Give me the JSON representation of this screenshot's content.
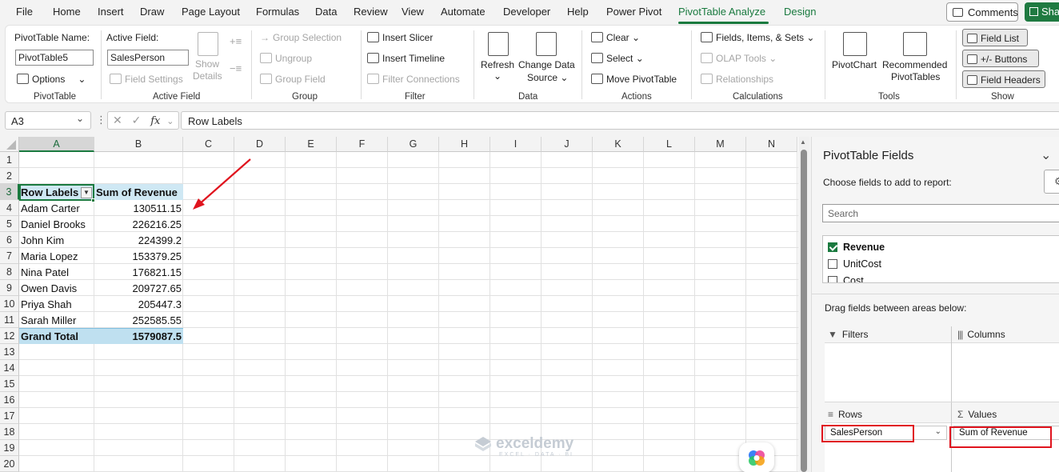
{
  "menu": {
    "tabs": [
      "File",
      "Home",
      "Insert",
      "Draw",
      "Page Layout",
      "Formulas",
      "Data",
      "Review",
      "View",
      "Automate",
      "Developer",
      "Help",
      "Power Pivot",
      "PivotTable Analyze",
      "Design"
    ],
    "active_tab": "PivotTable Analyze",
    "comments_label": "Comments",
    "share_label": "Share"
  },
  "ribbon": {
    "pivottable": {
      "name_label": "PivotTable Name:",
      "name_value": "PivotTable5",
      "options_label": "Options",
      "group_label": "PivotTable"
    },
    "active_field": {
      "label": "Active Field:",
      "value": "SalesPerson",
      "field_settings": "Field Settings",
      "show_details_1": "Show",
      "show_details_2": "Details",
      "group_label": "Active Field"
    },
    "group": {
      "group_selection": "Group Selection",
      "ungroup": "Ungroup",
      "group_field": "Group Field",
      "group_label": "Group"
    },
    "filter": {
      "insert_slicer": "Insert Slicer",
      "insert_timeline": "Insert Timeline",
      "filter_connections": "Filter Connections",
      "group_label": "Filter"
    },
    "data": {
      "refresh": "Refresh",
      "change_source_1": "Change Data",
      "change_source_2": "Source",
      "group_label": "Data"
    },
    "actions": {
      "clear": "Clear",
      "select": "Select",
      "move": "Move PivotTable",
      "group_label": "Actions"
    },
    "calculations": {
      "fields_items": "Fields, Items, & Sets",
      "olap": "OLAP Tools",
      "relationships": "Relationships",
      "group_label": "Calculations"
    },
    "tools": {
      "pivotchart": "PivotChart",
      "recommended_1": "Recommended",
      "recommended_2": "PivotTables",
      "group_label": "Tools"
    },
    "show": {
      "field_list": "Field List",
      "buttons": "+/- Buttons",
      "field_headers": "Field Headers",
      "group_label": "Show"
    }
  },
  "formula_bar": {
    "name_box": "A3",
    "fx": "fx",
    "value": "Row Labels"
  },
  "sheet": {
    "columns": [
      "A",
      "B",
      "C",
      "D",
      "E",
      "F",
      "G",
      "H",
      "I",
      "J",
      "K",
      "L",
      "M",
      "N"
    ],
    "rows": [
      "1",
      "2",
      "3",
      "4",
      "5",
      "6",
      "7",
      "8",
      "9",
      "10",
      "11",
      "12",
      "13",
      "14",
      "15",
      "16",
      "17",
      "18",
      "19",
      "20"
    ],
    "header_row_label": "Row Labels",
    "header_value_label": "Sum of Revenue",
    "data": [
      {
        "name": "Adam Carter",
        "value": "130511.15"
      },
      {
        "name": "Daniel Brooks",
        "value": "226216.25"
      },
      {
        "name": "John Kim",
        "value": "224399.2"
      },
      {
        "name": "Maria Lopez",
        "value": "153379.25"
      },
      {
        "name": "Nina Patel",
        "value": "176821.15"
      },
      {
        "name": "Owen Davis",
        "value": "209727.65"
      },
      {
        "name": "Priya Shah",
        "value": "205447.3"
      },
      {
        "name": "Sarah Miller",
        "value": "252585.55"
      }
    ],
    "grand_total_label": "Grand Total",
    "grand_total_value": "1579087.5"
  },
  "watermark": {
    "brand": "exceldemy",
    "tagline": "EXCEL · DATA · BI"
  },
  "pane": {
    "title": "PivotTable Fields",
    "subtitle": "Choose fields to add to report:",
    "search_placeholder": "Search",
    "fields": [
      {
        "label": "Revenue",
        "checked": true
      },
      {
        "label": "UnitCost",
        "checked": false
      },
      {
        "label": "Cost",
        "checked": false
      }
    ],
    "drag_hint": "Drag fields between areas below:",
    "filters_label": "Filters",
    "columns_label": "Columns",
    "rows_label": "Rows",
    "values_label": "Values",
    "rows_item": "SalesPerson",
    "values_item": "Sum of Revenue"
  },
  "colors": {
    "accent": "#1a7a3f",
    "highlight": "#e0141e",
    "pivot_header": "#cfe8f4"
  }
}
